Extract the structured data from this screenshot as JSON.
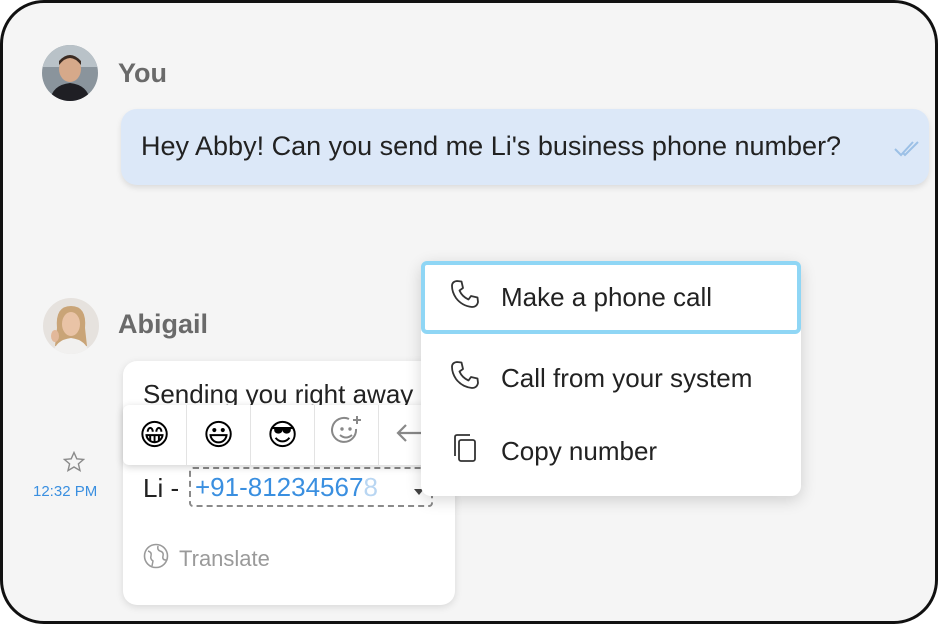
{
  "conversation": {
    "outgoing": {
      "sender": "You",
      "text": "Hey Abby! Can you send me Li's business phone number?"
    },
    "incoming": {
      "sender": "Abigail",
      "text_line1": "Sending you right away",
      "text_line2_prefix": "Li -",
      "phone_visible": "+91-81234567",
      "phone_faded": "8",
      "translate_label": "Translate",
      "time": "12:32 PM"
    }
  },
  "reactions": {
    "items": [
      "😁",
      "😃",
      "😎"
    ],
    "add_reaction_icon": "add-emoji-icon",
    "reply_icon": "reply-arrow-icon"
  },
  "context_menu": {
    "items": [
      {
        "label": "Make a phone call",
        "icon": "phone-icon",
        "selected": true
      },
      {
        "label": "Call from your system",
        "icon": "phone-icon",
        "selected": false
      },
      {
        "label": "Copy number",
        "icon": "copy-icon",
        "selected": false
      }
    ]
  },
  "colors": {
    "outgoing_bubble": "#dce8f8",
    "link_blue": "#3a8fe0",
    "selected_border": "#8fd6f5",
    "sender_gray": "#6a6a6a"
  }
}
